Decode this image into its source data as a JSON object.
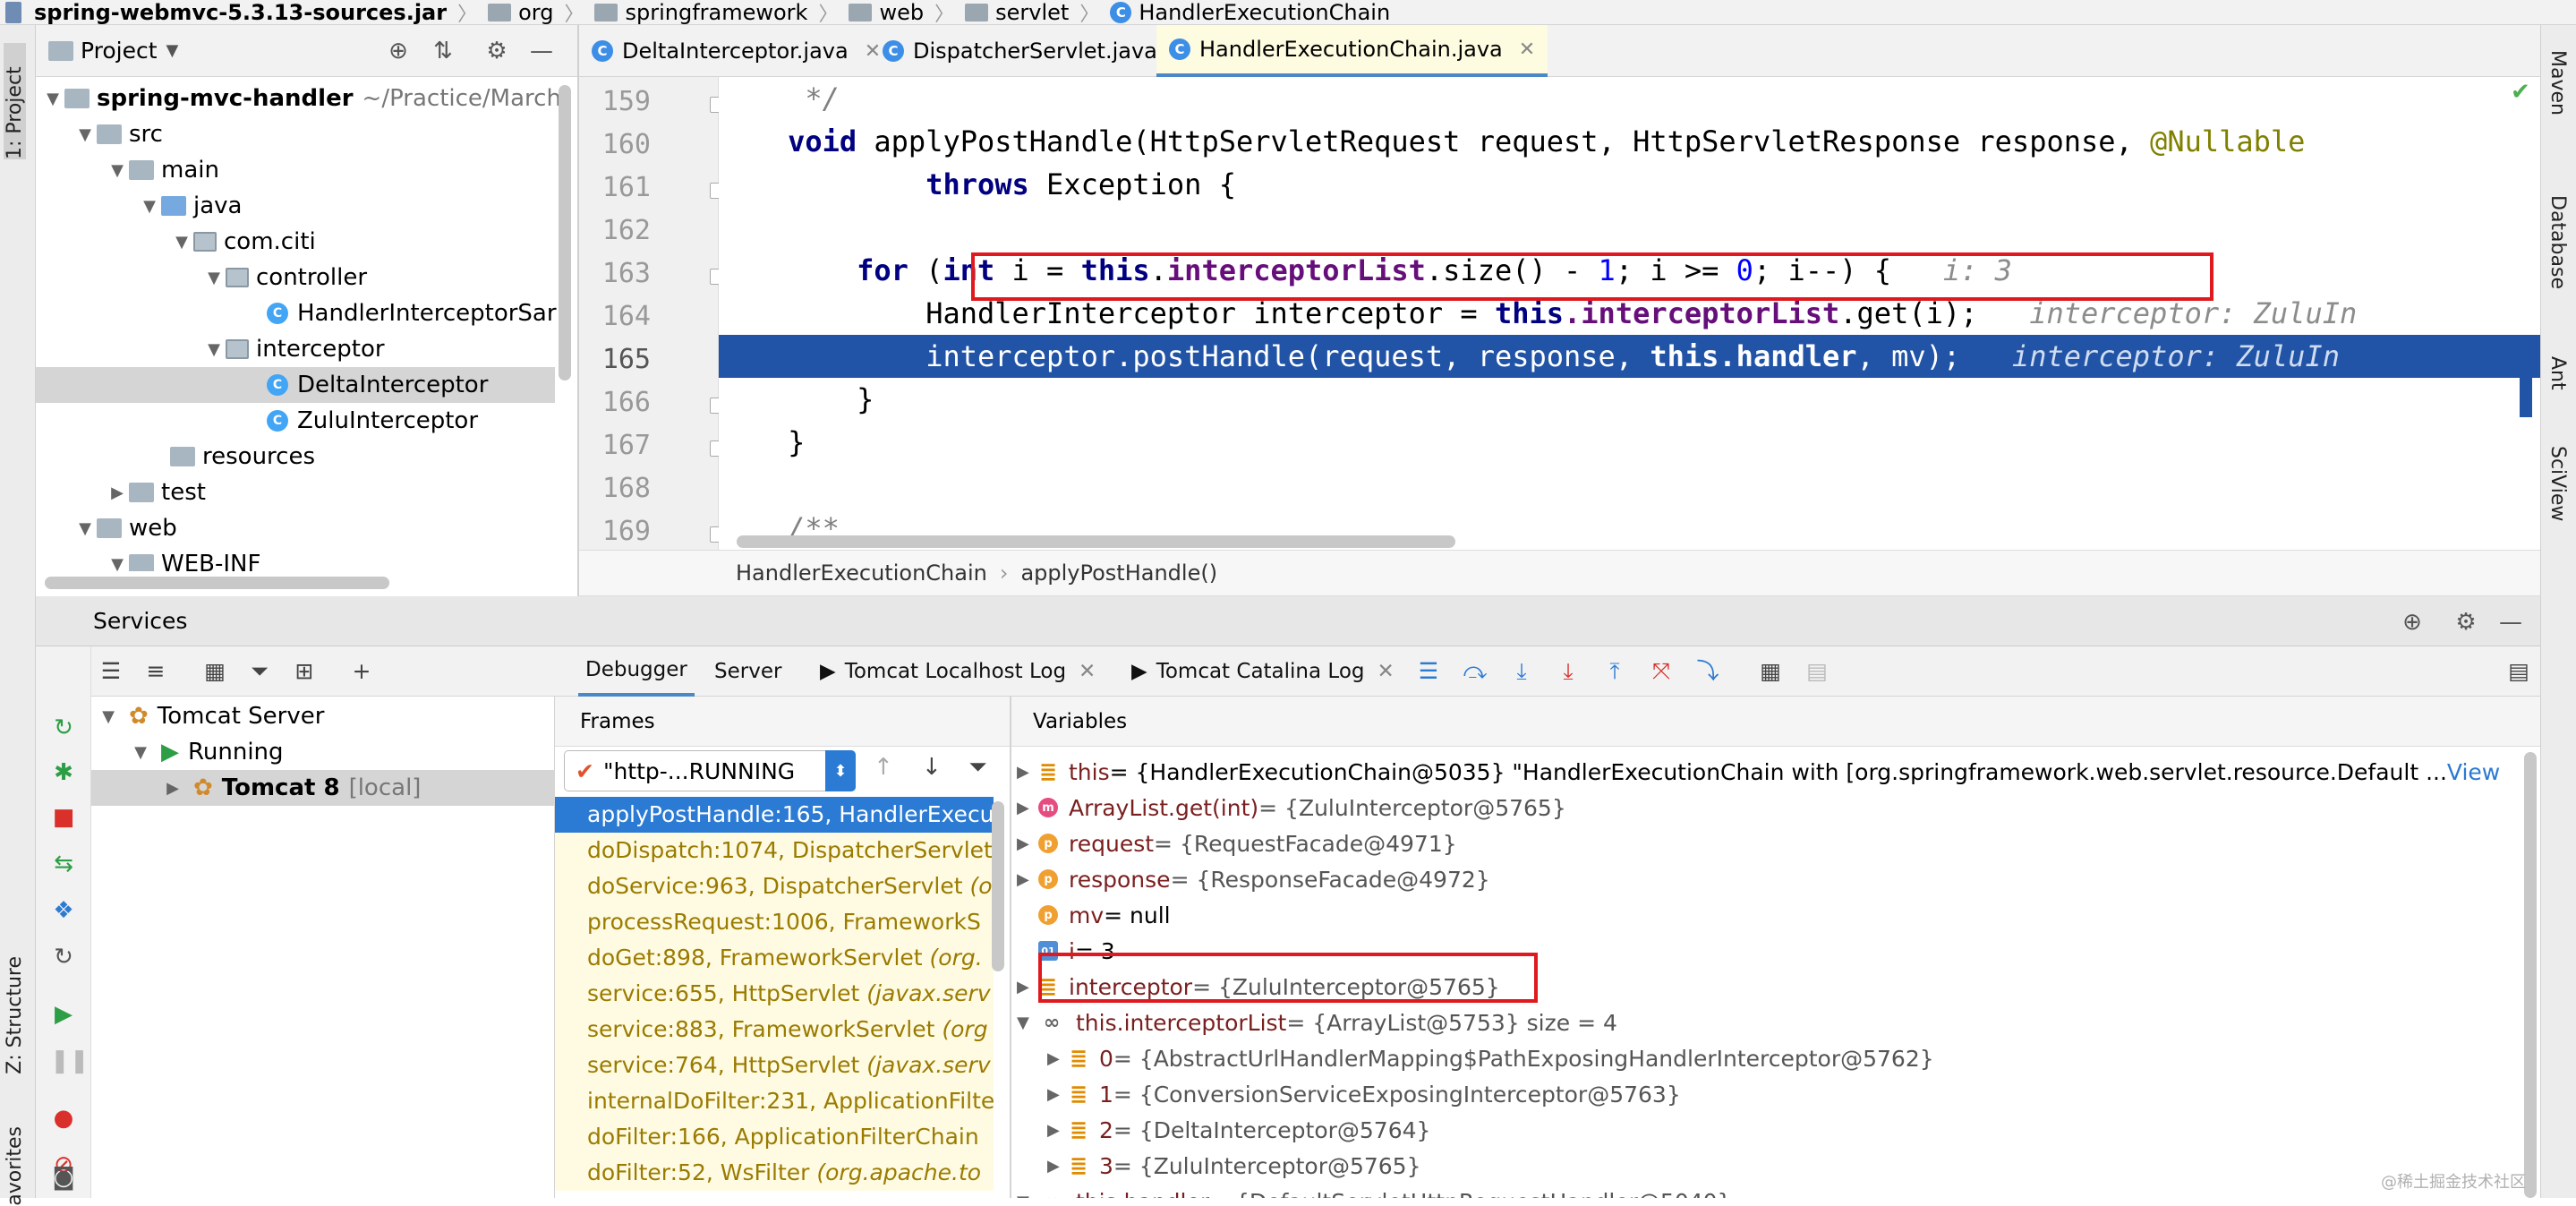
{
  "breadcrumb": {
    "items": [
      "spring-webmvc-5.3.13-sources.jar",
      "org",
      "springframework",
      "web",
      "servlet",
      "HandlerExecutionChain"
    ]
  },
  "left_strip": {
    "project_tab": "1: Project",
    "structure_tab": "Z: Structure",
    "favorites_tab": "avorites"
  },
  "right_strip": {
    "tabs": [
      "Maven",
      "Database",
      "Ant",
      "SciView"
    ]
  },
  "project": {
    "title": "Project",
    "tree": [
      {
        "label": "spring-mvc-handler",
        "suffix": "~/Practice/March/",
        "bold": true
      },
      {
        "label": "src"
      },
      {
        "label": "main"
      },
      {
        "label": "java"
      },
      {
        "label": "com.citi"
      },
      {
        "label": "controller"
      },
      {
        "label": "HandlerInterceptorSar"
      },
      {
        "label": "interceptor"
      },
      {
        "label": "DeltaInterceptor"
      },
      {
        "label": "ZuluInterceptor"
      },
      {
        "label": "resources"
      },
      {
        "label": "test"
      },
      {
        "label": "web"
      },
      {
        "label": "WEB-INF"
      }
    ]
  },
  "editor": {
    "tabs": [
      "DeltaInterceptor.java",
      "DispatcherServlet.java",
      "HandlerExecutionChain.java"
    ],
    "active_tab": "HandlerExecutionChain.java",
    "line_numbers": [
      "159",
      "160",
      "161",
      "162",
      "163",
      "164",
      "165",
      "166",
      "167",
      "168",
      "169"
    ],
    "code": {
      "l159": "     */",
      "l160_void": "    void",
      "l160_sig": " applyPostHandle(HttpServletRequest request, HttpServletResponse response, ",
      "l160_ann": "@Nullable",
      "l161_throws": "            throws",
      "l161_rest": " Exception {",
      "l163_for": "        for",
      "l163_open": " (",
      "l163_int": "int",
      "l163_i1": " i",
      "l163_eq": " = ",
      "l163_this": "this",
      "l163_dot": ".",
      "l163_field": "interceptorList",
      "l163_size": ".size() - ",
      "l163_one": "1",
      "l163_semi": "; i >= ",
      "l163_zero": "0",
      "l163_end": "; i--) {",
      "l163_hint": "   i: 3",
      "l164_type": "            HandlerInterceptor interceptor = ",
      "l164_this": "this",
      "l164_field": ".interceptorList",
      "l164_get": ".get(i);",
      "l164_hint": "   interceptor: ZuluIn",
      "l165_call": "            interceptor.postHandle(request, response, ",
      "l165_this": "this",
      "l165_field": ".handler",
      "l165_end": ", mv);",
      "l165_hint": "   interceptor: ZuluIn",
      "l166": "        }",
      "l167": "    }",
      "l169": "    /**"
    },
    "crumb": [
      "HandlerExecutionChain",
      "applyPostHandle()"
    ]
  },
  "services": {
    "title": "Services",
    "tree": [
      {
        "label": "Tomcat Server"
      },
      {
        "label": "Running"
      },
      {
        "label": "Tomcat 8",
        "suffix": "[local]"
      }
    ],
    "tabs": [
      "Debugger",
      "Server",
      "Tomcat Localhost Log",
      "Tomcat Catalina Log"
    ]
  },
  "frames": {
    "title": "Frames",
    "thread": "\"http-...RUNNING",
    "items": [
      {
        "method": "applyPostHandle:165, HandlerExecu",
        "pkg": ""
      },
      {
        "method": "doDispatch:1074, DispatcherServlet",
        "pkg": ""
      },
      {
        "method": "doService:963, DispatcherServlet",
        "pkg": " (o"
      },
      {
        "method": "processRequest:1006, FrameworkS",
        "pkg": ""
      },
      {
        "method": "doGet:898, FrameworkServlet",
        "pkg": " (org."
      },
      {
        "method": "service:655, HttpServlet",
        "pkg": " (javax.serv"
      },
      {
        "method": "service:883, FrameworkServlet",
        "pkg": " (org"
      },
      {
        "method": "service:764, HttpServlet",
        "pkg": " (javax.serv"
      },
      {
        "method": "internalDoFilter:231, ApplicationFilte",
        "pkg": ""
      },
      {
        "method": "doFilter:166, ApplicationFilterChain",
        "pkg": ""
      },
      {
        "method": "doFilter:52, WsFilter",
        "pkg": " (org.apache.to"
      }
    ]
  },
  "variables": {
    "title": "Variables",
    "items": [
      {
        "name": "this",
        "value": " = {HandlerExecutionChain@5035} \"HandlerExecutionChain with [org.springframework.web.servlet.resource.Default ... ",
        "link": "View"
      },
      {
        "name": "ArrayList.get(int)",
        "value": " = {ZuluInterceptor@5765}"
      },
      {
        "name": "request",
        "value": " = {RequestFacade@4971}"
      },
      {
        "name": "response",
        "value": " = {ResponseFacade@4972}"
      },
      {
        "name": "mv",
        "value": " = null"
      },
      {
        "name": "i",
        "value": " = 3"
      },
      {
        "name": "interceptor",
        "value": " = {ZuluInterceptor@5765}"
      },
      {
        "name": "this.interceptorList",
        "value": " = {ArrayList@5753}  size = 4"
      },
      {
        "name": "0",
        "value": " = {AbstractUrlHandlerMapping$PathExposingHandlerInterceptor@5762}"
      },
      {
        "name": "1",
        "value": " = {ConversionServiceExposingInterceptor@5763}"
      },
      {
        "name": "2",
        "value": " = {DeltaInterceptor@5764}"
      },
      {
        "name": "3",
        "value": " = {ZuluInterceptor@5765}"
      },
      {
        "name": "this.handler",
        "value": " = {DefaultServletHttpRequestHandler@5040}"
      }
    ]
  },
  "watermark": "@稀土掘金技术社区"
}
